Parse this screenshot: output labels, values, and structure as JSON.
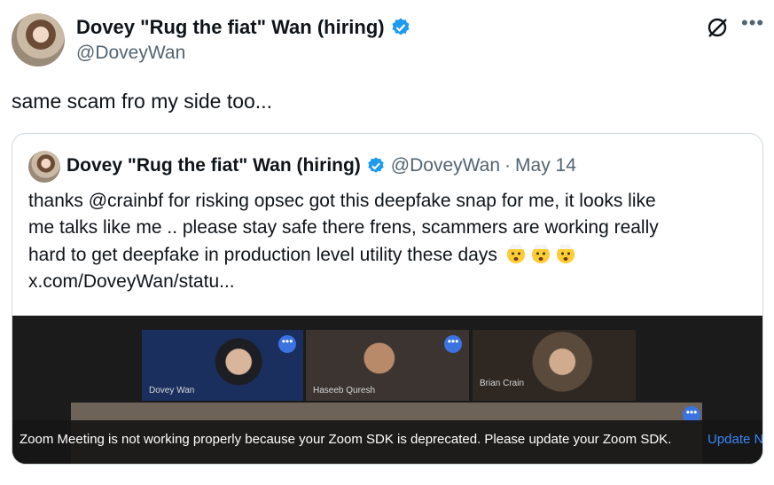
{
  "tweet": {
    "author_name": "Dovey \"Rug the fiat\" Wan (hiring)",
    "handle": "@DoveyWan",
    "text": "same scam fro my side too..."
  },
  "quote": {
    "author_name": "Dovey \"Rug the fiat\" Wan (hiring)",
    "handle": "@DoveyWan",
    "separator": "·",
    "date": "May 14",
    "text_lines": [
      "thanks @crainbf for risking opsec got this deepfake snap for me, it looks like",
      "me talks like me .. please stay safe there frens, scammers are working really",
      "hard to get deepfake in production level utility these days",
      "x.com/DoveyWan/statu..."
    ],
    "media": {
      "participants": [
        "Dovey Wan",
        "Haseeb Quresh",
        "Brian Crain"
      ],
      "tile_menu": "•••",
      "banner_text": "Zoom Meeting is not working properly because your Zoom SDK is deprecated. Please update your Zoom SDK.",
      "banner_link": "Update N"
    }
  },
  "icons": {
    "verified": "verified-badge-icon",
    "grok": "grok-icon",
    "more": "more-options-icon",
    "emoji": "exploding-head-emoji"
  },
  "colors": {
    "verified_blue": "#1d9bf0",
    "secondary_text": "#536471",
    "link_blue": "#3d86f5"
  }
}
